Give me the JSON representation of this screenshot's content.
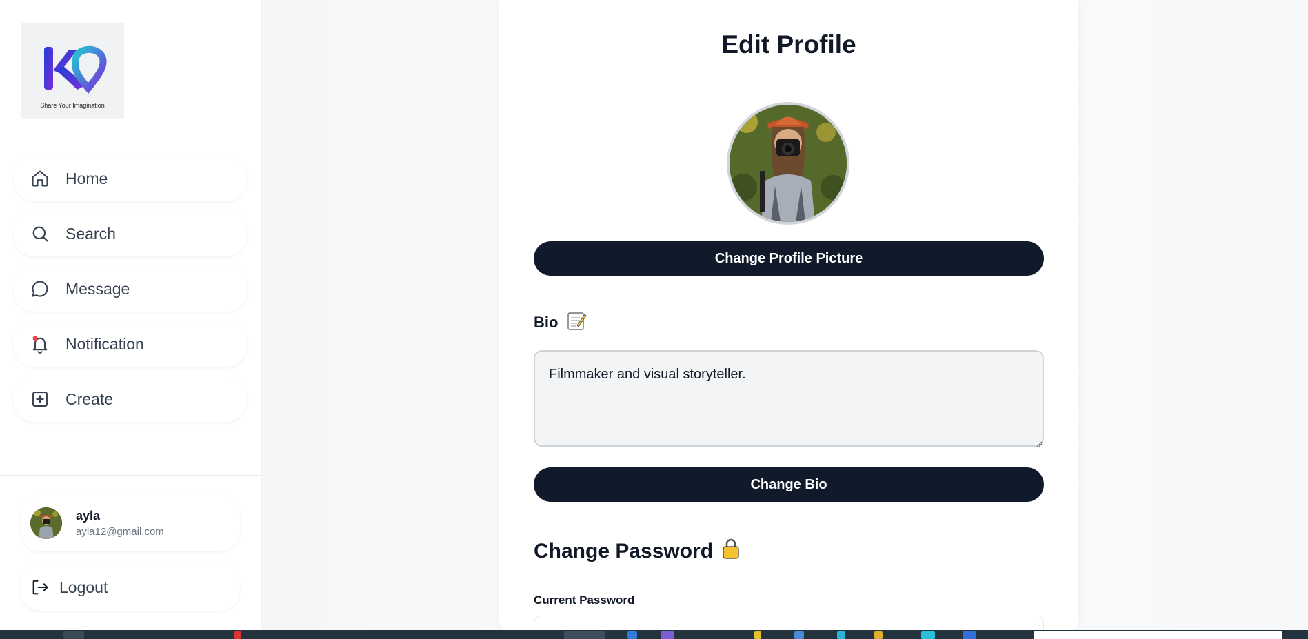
{
  "sidebar": {
    "logo": {
      "tagline": "Share Your Imagination",
      "brand_colors": [
        "#1e3fd6",
        "#7b2fd9",
        "#21c6d6"
      ]
    },
    "nav_items": [
      {
        "label": "Home",
        "icon": "home-icon"
      },
      {
        "label": "Search",
        "icon": "search-icon"
      },
      {
        "label": "Message",
        "icon": "message-icon"
      },
      {
        "label": "Notification",
        "icon": "bell-icon",
        "has_badge": true
      },
      {
        "label": "Create",
        "icon": "plus-square-icon"
      }
    ],
    "user": {
      "name": "ayla",
      "email": "ayla12@gmail.com"
    },
    "logout_label": "Logout"
  },
  "main": {
    "title": "Edit Profile",
    "change_picture_label": "Change Profile Picture",
    "bio": {
      "label": "Bio",
      "emoji": "📝",
      "value": "Filmmaker and visual storyteller."
    },
    "change_bio_label": "Change Bio",
    "password": {
      "title": "Change Password",
      "emoji": "🔒",
      "current_label": "Current Password"
    }
  },
  "colors": {
    "button_dark": "#111a2b",
    "notification_badge": "#ef4444",
    "taskbar": "#24343f"
  }
}
